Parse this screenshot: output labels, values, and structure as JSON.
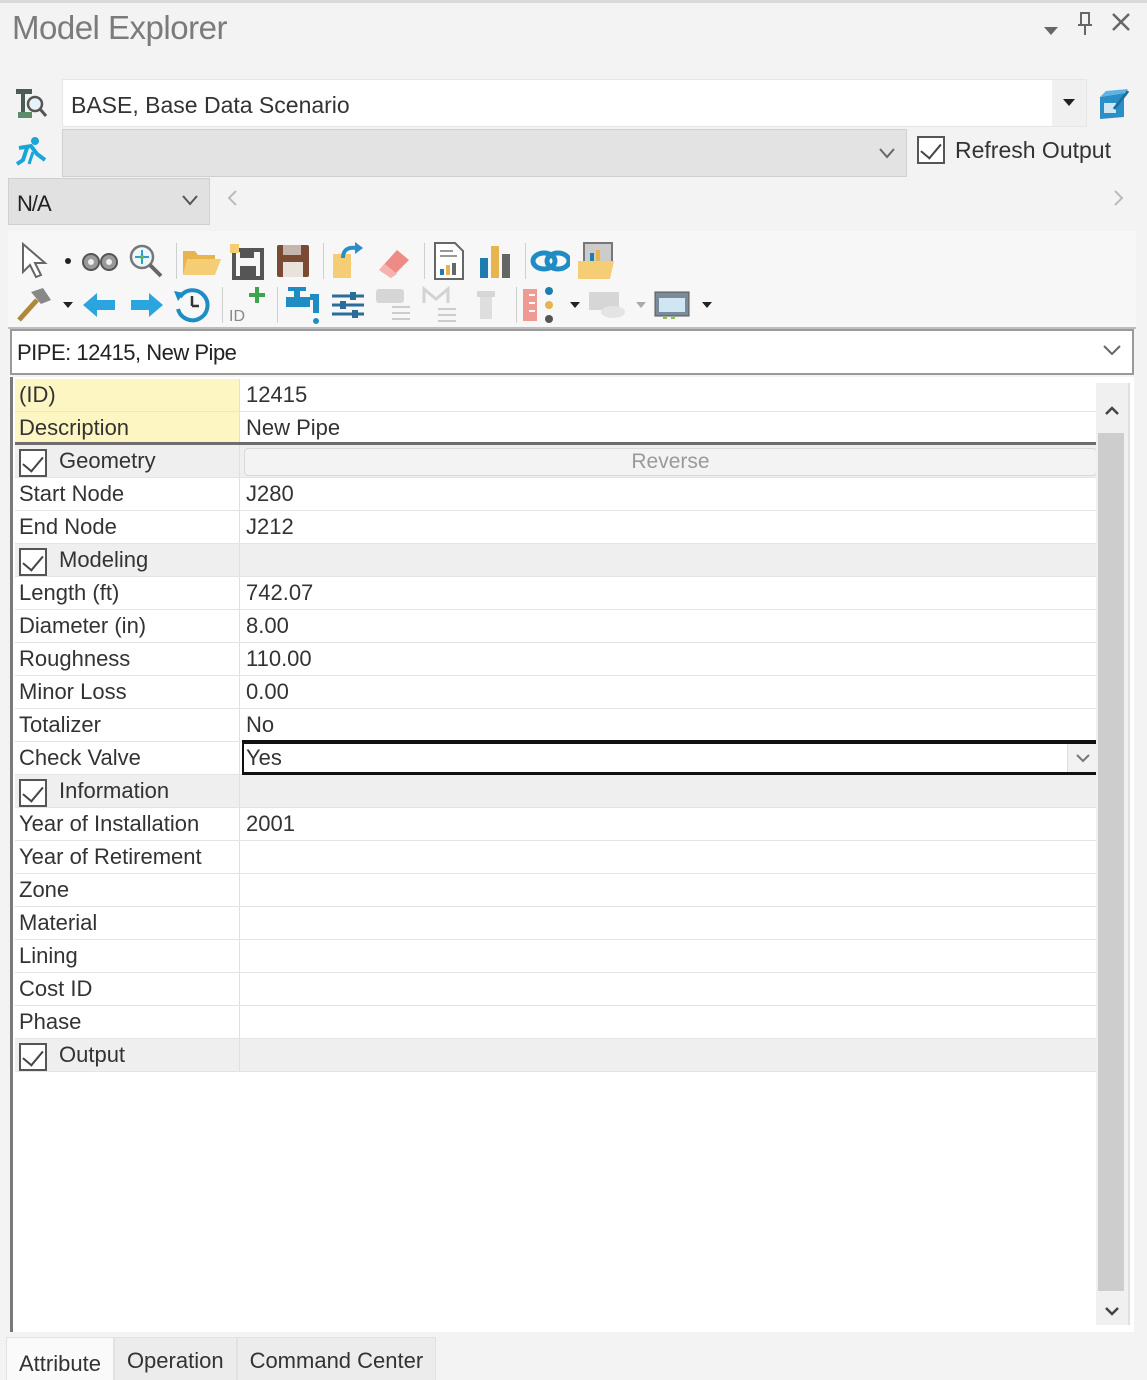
{
  "window": {
    "title": "Model Explorer",
    "controls": [
      "dropdown",
      "pin",
      "close"
    ]
  },
  "scenario": {
    "value": "BASE, Base Data Scenario",
    "icon": "scenario-search-icon",
    "action_icon": "scenario-properties-icon"
  },
  "alternative": {
    "value": "",
    "icon": "run-icon",
    "refresh_output": {
      "label": "Refresh Output",
      "checked": true
    }
  },
  "filter": {
    "value": "N/A"
  },
  "toolbar": {
    "row1": [
      "select-pointer-icon",
      "dropdown",
      "binoculars-icon",
      "zoom-to-icon",
      "open-folder-icon",
      "new-save-icon",
      "save-icon",
      "import-icon",
      "eraser-icon",
      "report-icon",
      "graph-icon",
      "link-icon",
      "open-report-folder-icon"
    ],
    "row2": [
      "hammer-icon",
      "dropdown",
      "back-arrow-icon",
      "forward-arrow-icon",
      "history-icon",
      "add-id-icon",
      "tap-icon",
      "settings-lines-icon",
      "message-icon",
      "split-icon",
      "filter-icon",
      "color-code-icon",
      "dropdown",
      "view-icon",
      "dropdown",
      "grid-view-icon",
      "dropdown"
    ]
  },
  "element": {
    "value": "PIPE: 12415, New Pipe"
  },
  "properties": {
    "key_rows": [
      {
        "label": "(ID)",
        "value": "12415"
      },
      {
        "label": "Description",
        "value": "New Pipe"
      }
    ],
    "geometry": {
      "label": "Geometry",
      "expanded": true,
      "action": "Reverse",
      "rows": [
        {
          "label": "Start Node",
          "value": "J280"
        },
        {
          "label": "End Node",
          "value": "J212"
        }
      ]
    },
    "modeling": {
      "label": "Modeling",
      "expanded": true,
      "rows": [
        {
          "label": "Length (ft)",
          "value": "742.07"
        },
        {
          "label": "Diameter (in)",
          "value": "8.00"
        },
        {
          "label": "Roughness",
          "value": "110.00"
        },
        {
          "label": "Minor Loss",
          "value": "0.00"
        },
        {
          "label": "Totalizer",
          "value": "No"
        }
      ],
      "editing": {
        "label": "Check Valve",
        "value": "Yes"
      }
    },
    "information": {
      "label": "Information",
      "expanded": true,
      "rows": [
        {
          "label": "Year of Installation",
          "value": "2001"
        },
        {
          "label": "Year of Retirement",
          "value": ""
        },
        {
          "label": "Zone",
          "value": ""
        },
        {
          "label": "Material",
          "value": ""
        },
        {
          "label": "Lining",
          "value": ""
        },
        {
          "label": "Cost ID",
          "value": ""
        },
        {
          "label": "Phase",
          "value": ""
        }
      ]
    },
    "output": {
      "label": "Output",
      "expanded": true
    }
  },
  "tabs": [
    {
      "label": "Attribute",
      "active": true
    },
    {
      "label": "Operation",
      "active": false
    },
    {
      "label": "Command Center",
      "active": false
    }
  ]
}
